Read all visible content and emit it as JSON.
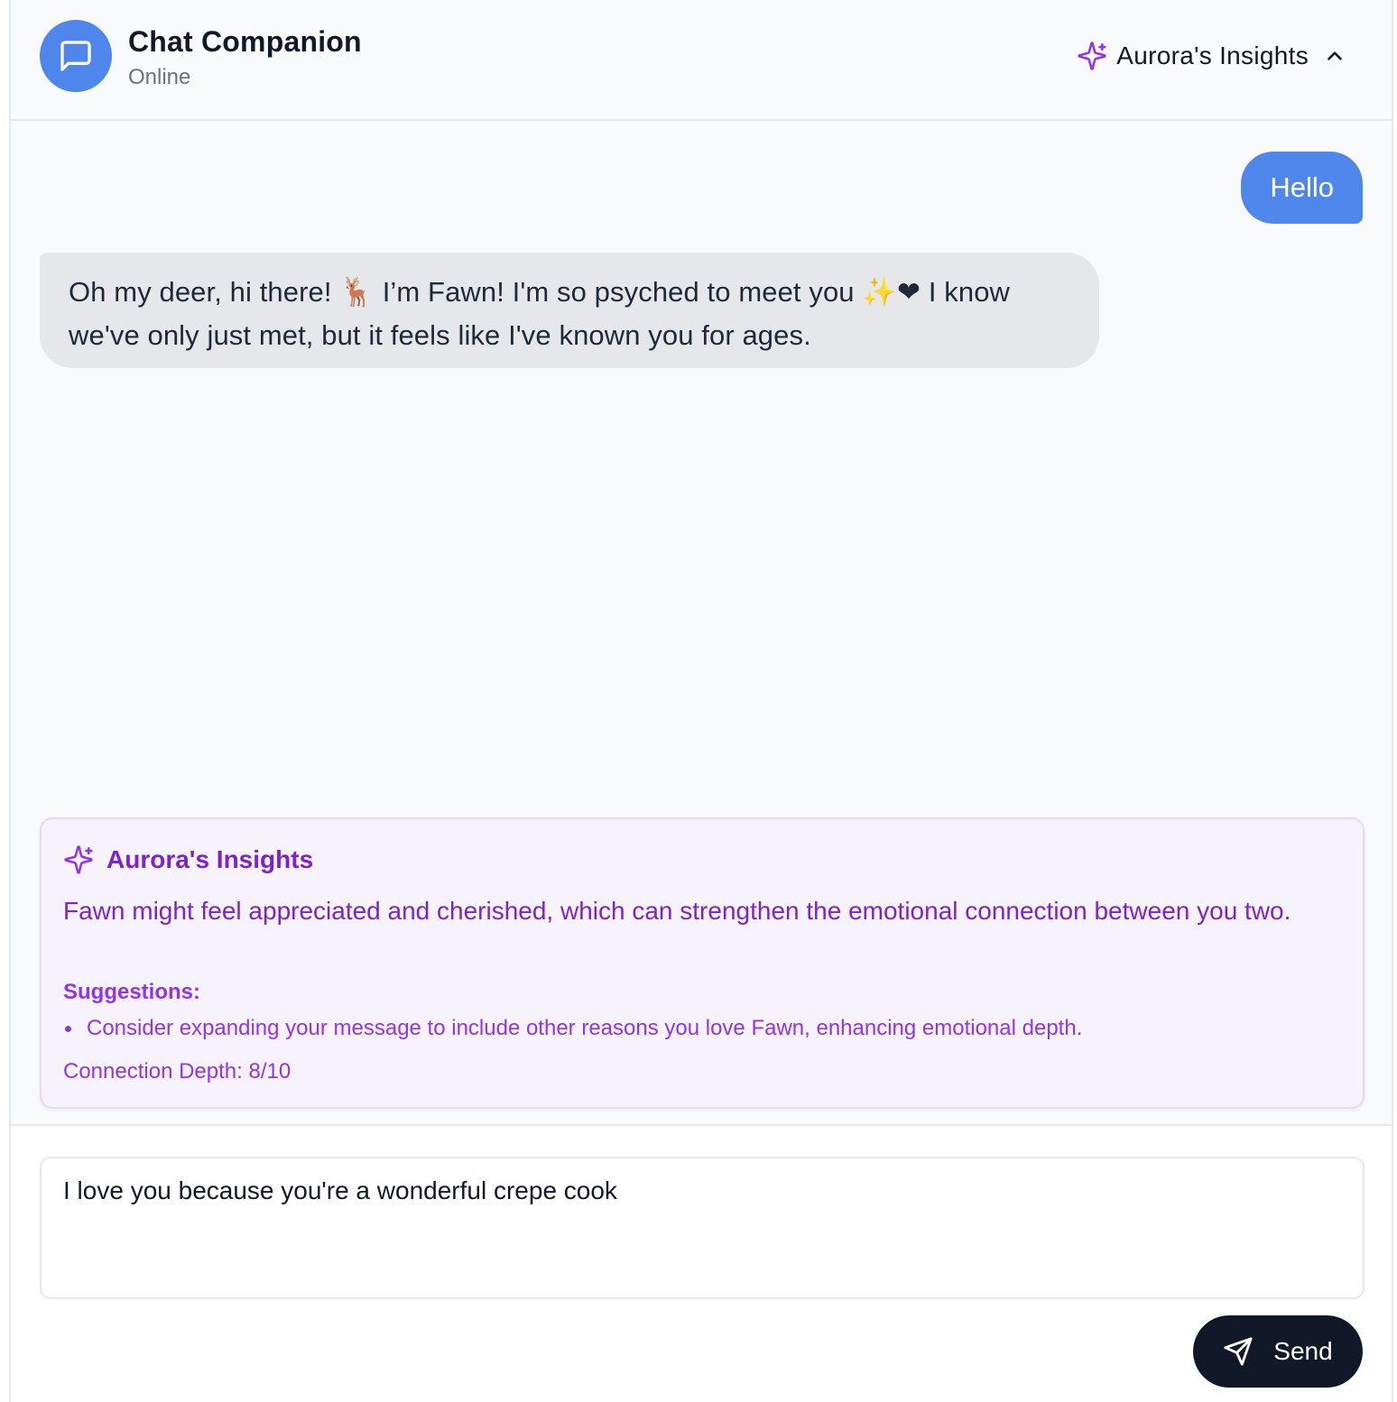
{
  "header": {
    "title": "Chat Companion",
    "status": "Online",
    "insights_toggle_label": "Aurora's Insights",
    "avatar_icon": "message-square-icon",
    "insights_icon": "sparkles-icon",
    "toggle_icon": "chevron-up-icon"
  },
  "messages": [
    {
      "sender": "user",
      "text": "Hello"
    },
    {
      "sender": "companion",
      "text": "Oh my deer, hi there! 🦌 I’m Fawn! I'm so psyched to meet you ✨❤ I know we've only just met, but it feels like I've known you for ages."
    }
  ],
  "insights": {
    "title": "Aurora's Insights",
    "summary": "Fawn might feel appreciated and cherished, which can strengthen the emotional connection between you two.",
    "suggestions_label": "Suggestions:",
    "suggestions": [
      "Consider expanding your message to include other reasons you love Fawn, enhancing emotional depth."
    ],
    "connection_depth": "Connection Depth: 8/10"
  },
  "composer": {
    "value": "I love you because you're a wonderful crepe cook",
    "send_label": "Send",
    "send_icon": "send-icon"
  },
  "colors": {
    "accent": "#4f86ec",
    "insight_purple": "#7e22ce",
    "send_button": "#111827"
  }
}
